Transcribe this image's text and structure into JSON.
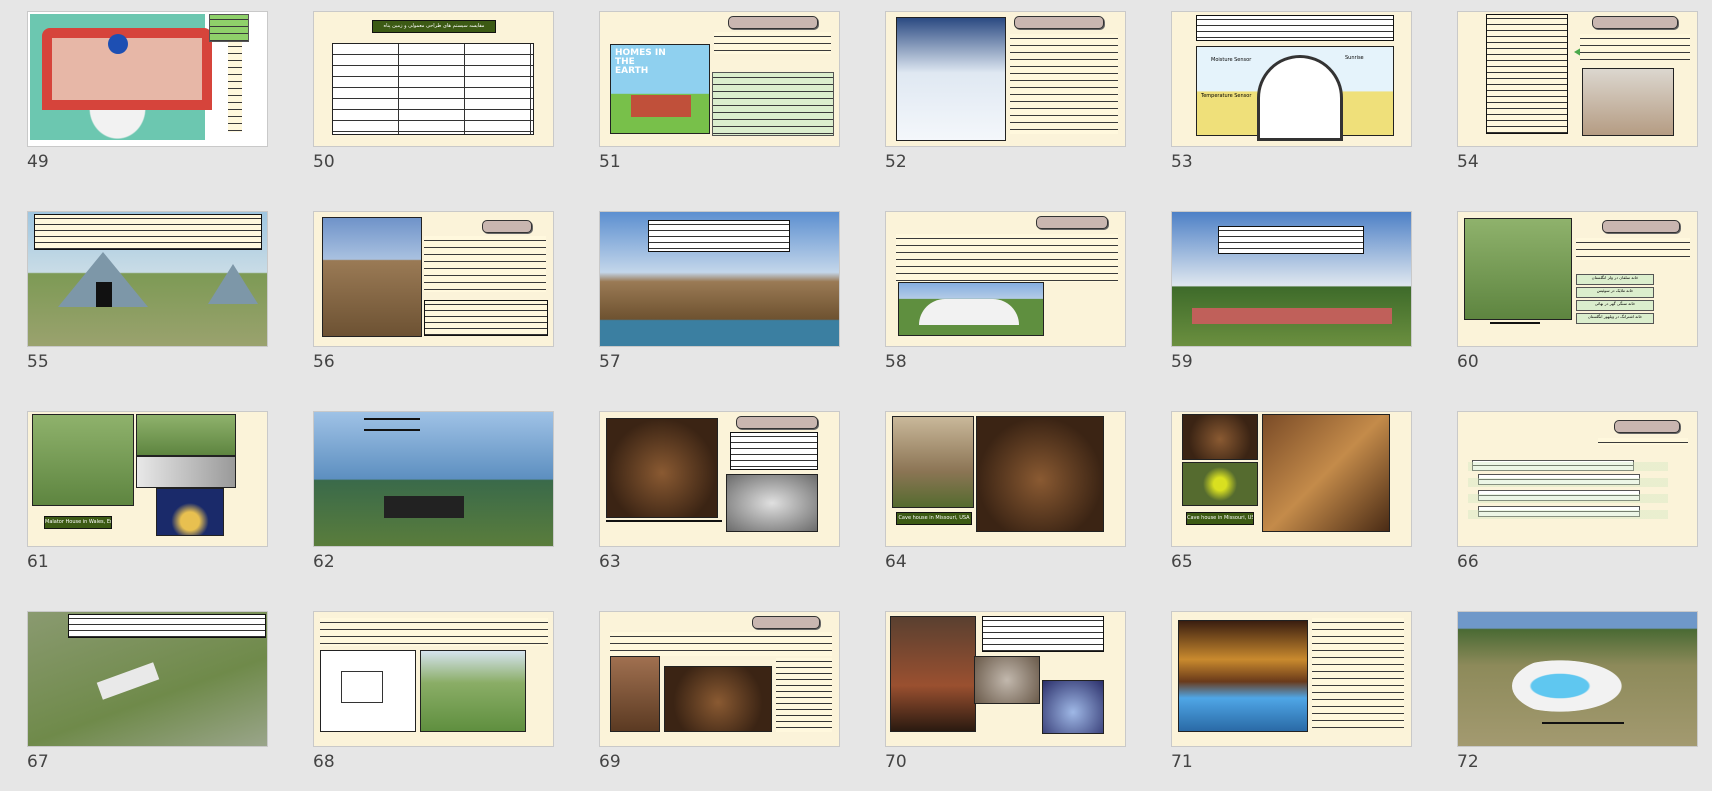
{
  "slides": [
    {
      "number": "49"
    },
    {
      "number": "50"
    },
    {
      "number": "51"
    },
    {
      "number": "52"
    },
    {
      "number": "53"
    },
    {
      "number": "54"
    },
    {
      "number": "55"
    },
    {
      "number": "56"
    },
    {
      "number": "57"
    },
    {
      "number": "58"
    },
    {
      "number": "59"
    },
    {
      "number": "60"
    },
    {
      "number": "61"
    },
    {
      "number": "62"
    },
    {
      "number": "63"
    },
    {
      "number": "64"
    },
    {
      "number": "65"
    },
    {
      "number": "66"
    },
    {
      "number": "67"
    },
    {
      "number": "68"
    },
    {
      "number": "69"
    },
    {
      "number": "70"
    },
    {
      "number": "71"
    },
    {
      "number": "72"
    }
  ],
  "text": {
    "s50_title": "مقایسه سیستم های طراحی معمولی و زمین پناه",
    "s50_headers": [
      "ردیف",
      "مولفه",
      "ساختمان معمولی",
      "ساختمان زمین پناه"
    ],
    "s51_cover_title": "HOMES IN THE EARTH",
    "s53_label_moisture": "Moisture Sensor",
    "s53_label_temp": "Temperature Sensor",
    "s53_label_sunrise": "Sunrise",
    "s61_caption": "Malator House in Wales, England",
    "s64_caption": "Cave house in Missouri, USA",
    "s65_caption": "Cave house in Missouri, USA",
    "s60_items": [
      "خانه سلفان در ولز انگلستان",
      "خانه ملایک در سوئیس",
      "خانه سنگی گهر در بهائی",
      "خانه اشترانگ در ویلهور انگلستان"
    ]
  }
}
